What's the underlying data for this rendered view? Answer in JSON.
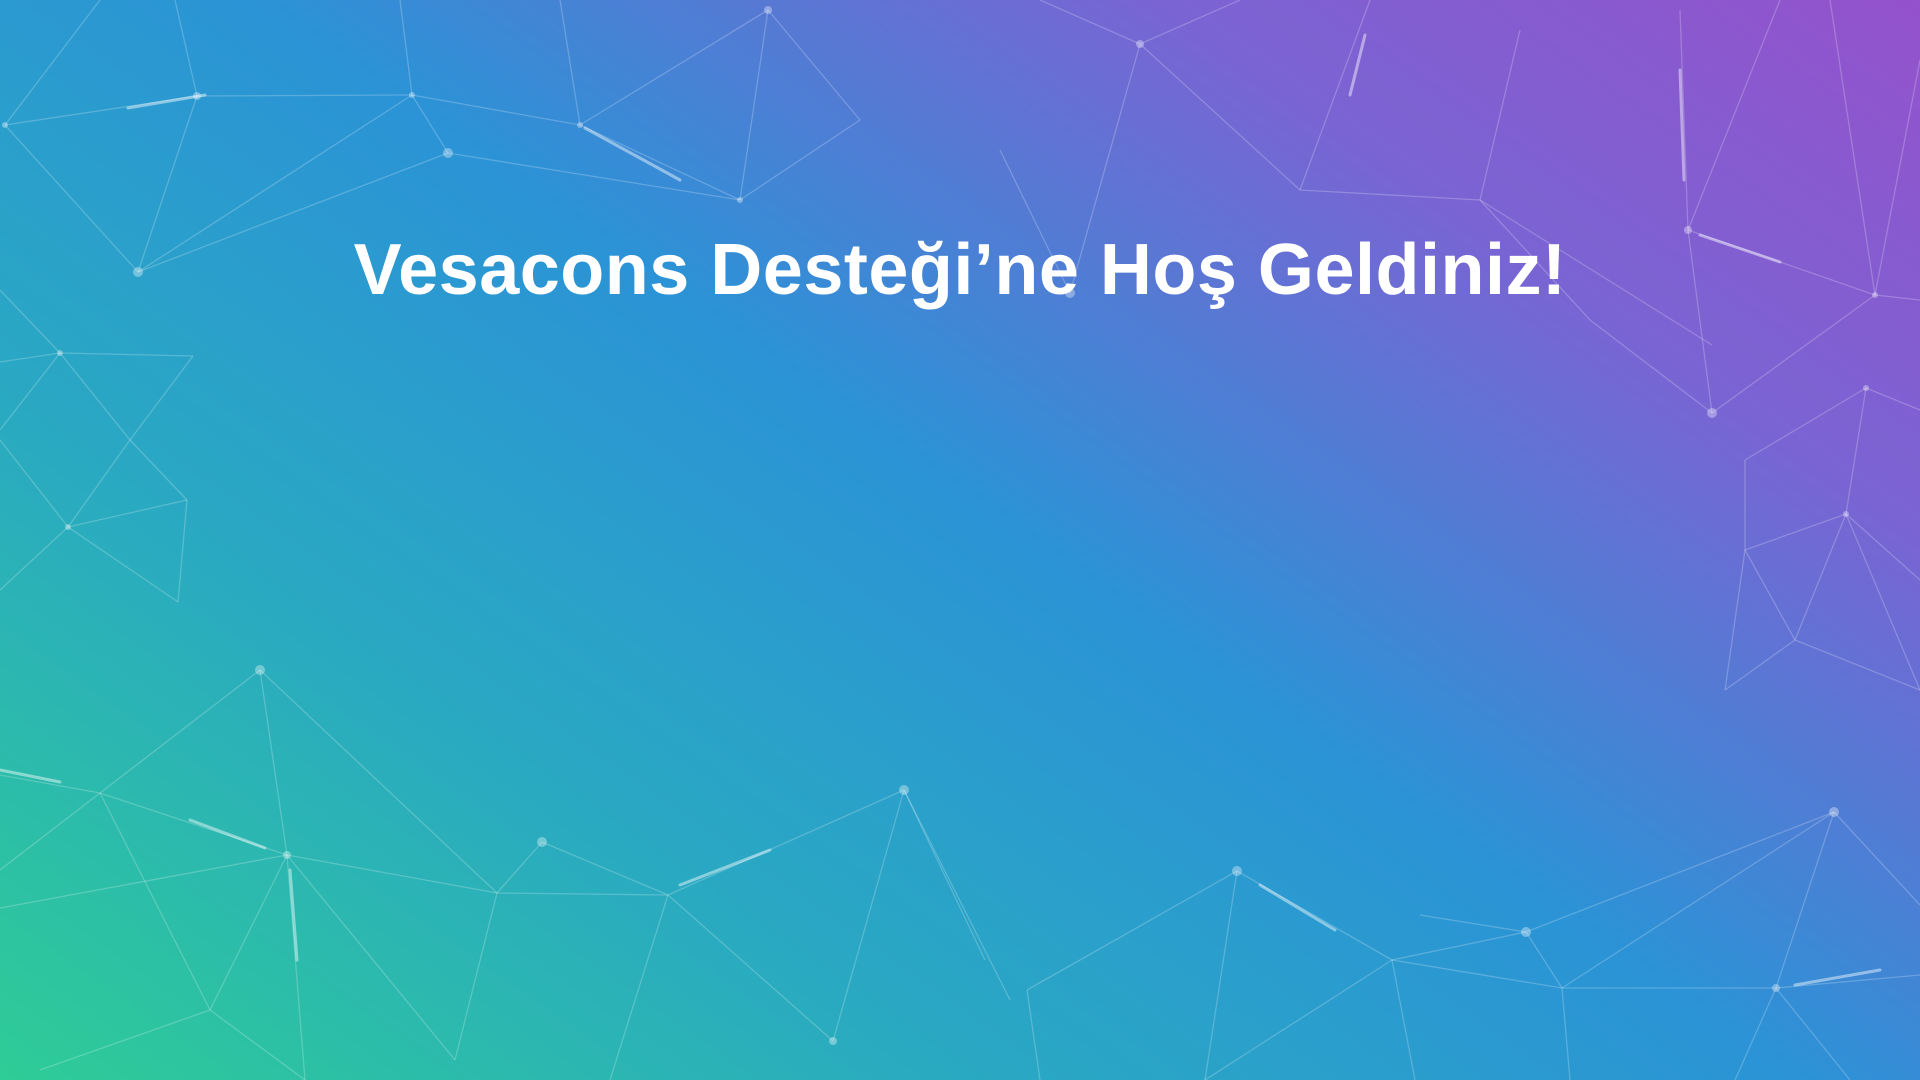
{
  "page": {
    "welcome_title": "Vesacons Desteği’ne Hoş Geldiniz!"
  },
  "theme": {
    "gradient_colors": [
      "#9452cc",
      "#7a64d3",
      "#2b93d6",
      "#2aa9c2",
      "#2ecc96"
    ],
    "text_color": "#ffffff"
  }
}
